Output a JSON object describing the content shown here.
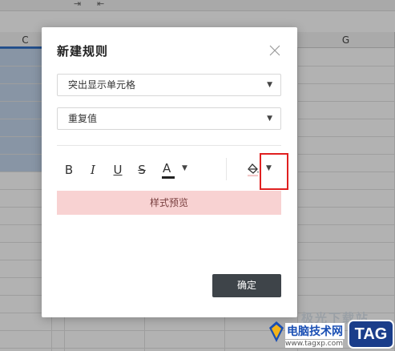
{
  "spreadsheet": {
    "toolbar_glyphs": [
      "⇥",
      "⇤"
    ],
    "column_labels": {
      "c": "C",
      "g": "G"
    }
  },
  "dialog": {
    "title": "新建规则",
    "rule_type_select": {
      "value": "突出显示单元格"
    },
    "condition_select": {
      "value": "重复值"
    },
    "format_toolbar": {
      "bold": "B",
      "italic": "I",
      "underline": "U",
      "strikethrough": "S",
      "font_color": "A"
    },
    "preview_label": "样式预览",
    "ok_label": "确定"
  },
  "watermark": {
    "top_text": "极光下载站",
    "main_text": "电脑技术网",
    "url": "www.tagxp.com",
    "tag": "TAG"
  },
  "colors": {
    "preview_bg": "#f8d2d2",
    "ok_button_bg": "#3e4449",
    "highlight_border": "#e02020",
    "selection_bg": "#c3d6ec"
  }
}
